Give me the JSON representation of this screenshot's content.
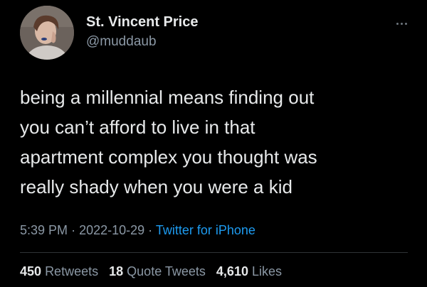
{
  "author": {
    "display_name": "St. Vincent Price",
    "handle": "@muddaub"
  },
  "tweet": {
    "text": "being a millennial means finding out\nyou can’t afford to live in that\napartment complex you thought was\nreally shady when you were a kid",
    "time": "5:39 PM",
    "separator": "·",
    "date": "2022-10-29",
    "source": "Twitter for iPhone"
  },
  "stats": {
    "retweets_count": "450",
    "retweets_label": "Retweets",
    "quotes_count": "18",
    "quotes_label": "Quote Tweets",
    "likes_count": "4,610",
    "likes_label": "Likes"
  },
  "icons": {
    "more": "more-dots-icon",
    "avatar": "avatar"
  },
  "colors": {
    "background": "#000000",
    "primary_text": "#e7e9ea",
    "secondary_text": "#8b98a5",
    "link": "#1d9bf0",
    "divider": "#2f3336"
  }
}
